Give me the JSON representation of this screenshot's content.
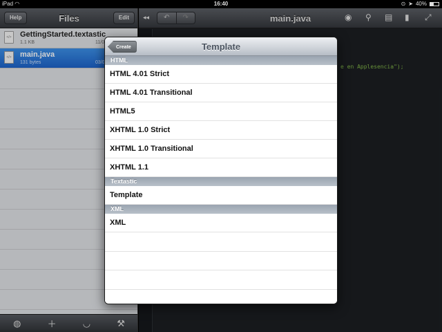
{
  "status": {
    "device": "iPad",
    "time": "16:40",
    "battery": "40%"
  },
  "sidebar": {
    "title": "Files",
    "help_label": "Help",
    "edit_label": "Edit",
    "files": [
      {
        "name": "GettingStarted.textastic",
        "size": "1.1 KB",
        "date": "11/0"
      },
      {
        "name": "main.java",
        "size": "131 bytes",
        "date": "03/0"
      }
    ],
    "toolbar_icons": [
      "globe-icon",
      "plus-icon",
      "wifi-icon",
      "wrench-icon"
    ]
  },
  "editor": {
    "title": "main.java",
    "code_snippet": "e en Applesencia\");",
    "toolbar_icons": [
      "back-forward-icon",
      "undo-icon",
      "redo-icon",
      "eye-icon",
      "search-icon",
      "snippets-icon",
      "document-icon",
      "fullscreen-icon"
    ]
  },
  "popover": {
    "back_label": "Create",
    "title": "Template",
    "sections": [
      {
        "header": "HTML",
        "items": [
          "HTML 4.01 Strict",
          "HTML 4.01 Transitional",
          "HTML5",
          "XHTML 1.0 Strict",
          "XHTML 1.0 Transitional",
          "XHTML 1.1"
        ]
      },
      {
        "header": "Textastic",
        "items": [
          "Template"
        ]
      },
      {
        "header": "XML",
        "items": [
          "XML"
        ]
      }
    ]
  },
  "colors": {
    "selection": "#1d63c9",
    "navbar": "#45484d",
    "section_header": "#a9b2bc",
    "code_green": "#7fb347"
  }
}
